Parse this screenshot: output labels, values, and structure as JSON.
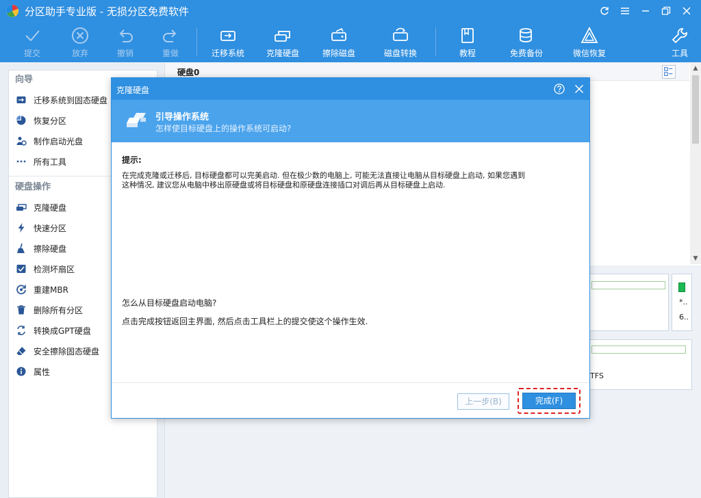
{
  "app": {
    "title": "分区助手专业版 - 无损分区免费软件"
  },
  "toolbar": {
    "submit": "提交",
    "discard": "放弃",
    "undo": "撤销",
    "redo": "重做",
    "migrate_os": "迁移系统",
    "clone_disk": "克隆硬盘",
    "wipe_disk": "擦除磁盘",
    "disk_convert": "磁盘转换",
    "tutorial": "教程",
    "free_backup": "免费备份",
    "wechat_recovery": "微信恢复",
    "tools": "工具"
  },
  "sidebar": {
    "wizard_title": "向导",
    "wizard_items": [
      "迁移系统到固态硬盘",
      "恢复分区",
      "制作启动光盘",
      "所有工具"
    ],
    "disk_ops_title": "硬盘操作",
    "disk_ops_items": [
      "克隆硬盘",
      "快速分区",
      "擦除硬盘",
      "检测坏扇区",
      "重建MBR",
      "删除所有分区",
      "转换成GPT硬盘",
      "安全擦除固态硬盘",
      "属性"
    ]
  },
  "main": {
    "disk_label": "硬盘0",
    "card1": {
      "line1": "*..",
      "line2": "6.."
    },
    "card2": {
      "fs": "TFS"
    }
  },
  "dialog": {
    "title": "克隆硬盘",
    "banner_title": "引导操作系统",
    "banner_subtitle": "怎样使目标硬盘上的操作系统可启动?",
    "hint_title": "提示:",
    "hint_line1": "在完成克隆或迁移后, 目标硬盘都可以完美启动. 但在极少数的电脑上, 可能无法直接让电脑从目标硬盘上启动, 如果您遇到",
    "hint_line2": "这种情况, 建议您从电脑中移出原硬盘或将目标硬盘和原硬盘连接插口对调后再从目标硬盘上启动.",
    "question": "怎么从目标硬盘启动电脑?",
    "answer": "点击完成按钮返回主界面, 然后点击工具栏上的提交使这个操作生效.",
    "prev_button": "上一步(B)",
    "finish_button": "完成(F)"
  },
  "colors": {
    "accent": "#2f8fe0",
    "banner": "#4ba3ec",
    "highlight_border": "#e02020"
  }
}
